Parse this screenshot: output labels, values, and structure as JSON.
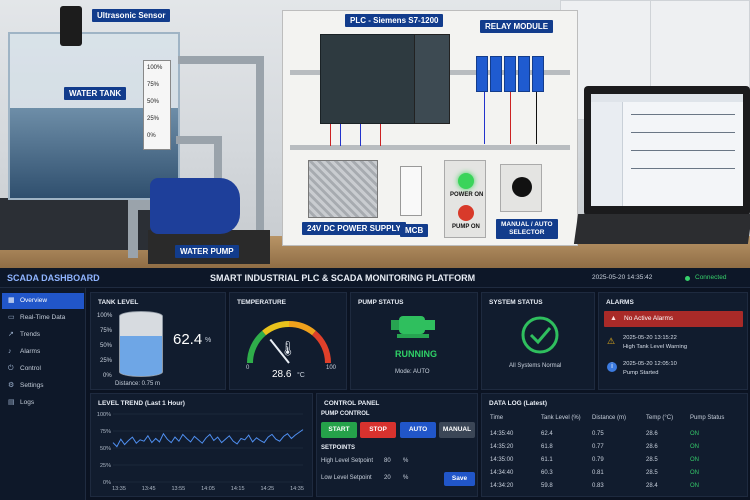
{
  "photo": {
    "labels": {
      "ultrasonic_sensor": "Ultrasonic Sensor",
      "plc": "PLC - Siemens S7-1200",
      "relay_module": "RELAY MODULE",
      "water_tank": "WATER TANK",
      "water_pump": "WATER PUMP",
      "power_supply": "24V DC POWER SUPPLY",
      "mcb": "MCB",
      "manual_auto_selector": "MANUAL / AUTO\nSELECTOR",
      "power_on": "POWER ON",
      "pump_on": "PUMP ON"
    },
    "tank_scale": [
      "100%",
      "75%",
      "50%",
      "25%",
      "0%"
    ]
  },
  "dashboard": {
    "brand": "SCADA DASHBOARD",
    "title": "SMART INDUSTRIAL PLC & SCADA MONITORING PLATFORM",
    "timestamp": "2025-05-20  14:35:42",
    "connection": "Connected",
    "nav": [
      {
        "label": "Overview",
        "icon": "grid-icon",
        "glyph": "▦",
        "active": true
      },
      {
        "label": "Real-Time Data",
        "icon": "monitor-icon",
        "glyph": "▭",
        "active": false
      },
      {
        "label": "Trends",
        "icon": "trend-icon",
        "glyph": "↗",
        "active": false
      },
      {
        "label": "Alarms",
        "icon": "bell-icon",
        "glyph": "♪",
        "active": false
      },
      {
        "label": "Control",
        "icon": "power-icon",
        "glyph": "⏻",
        "active": false
      },
      {
        "label": "Settings",
        "icon": "gear-icon",
        "glyph": "⚙",
        "active": false
      },
      {
        "label": "Logs",
        "icon": "document-icon",
        "glyph": "▤",
        "active": false
      }
    ],
    "tank_level": {
      "title": "TANK LEVEL",
      "scale": [
        "100%",
        "75%",
        "50%",
        "25%",
        "0%"
      ],
      "value": "62.4",
      "unit": "%",
      "fill": 0.624,
      "distance": "Distance: 0.75 m"
    },
    "temperature": {
      "title": "TEMPERATURE",
      "min": "0",
      "max": "100",
      "value": "28.6",
      "unit": "°C",
      "fraction": 0.286
    },
    "pump_status": {
      "title": "PUMP STATUS",
      "state": "RUNNING",
      "mode": "Mode: AUTO"
    },
    "system_status": {
      "title": "SYSTEM STATUS",
      "text": "All Systems Normal"
    },
    "alarms": {
      "title": "ALARMS",
      "banner": "No Active Alarms",
      "items": [
        {
          "time": "2025-05-20  13:15:22",
          "text": "High Tank Level Warning",
          "icon": "warning-icon"
        },
        {
          "time": "2025-05-20  12:05:10",
          "text": "Pump Started",
          "icon": "info-icon"
        }
      ]
    },
    "level_trend": {
      "title": "LEVEL TREND (Last 1 Hour)"
    },
    "control_panel": {
      "title": "CONTROL PANEL",
      "pump_control_label": "PUMP CONTROL",
      "buttons": {
        "start": "START",
        "stop": "STOP",
        "auto": "AUTO",
        "manual": "MANUAL"
      },
      "setpoints_label": "SETPOINTS",
      "high_label": "High Level Setpoint",
      "high_value": "80",
      "low_label": "Low Level Setpoint",
      "low_value": "20",
      "unit": "%",
      "save": "Save"
    },
    "data_log": {
      "title": "DATA LOG (Latest)",
      "columns": [
        "Time",
        "Tank Level (%)",
        "Distance (m)",
        "Temp (°C)",
        "Pump Status"
      ],
      "rows": [
        [
          "14:35:40",
          "62.4",
          "0.75",
          "28.6",
          "ON"
        ],
        [
          "14:35:20",
          "61.8",
          "0.77",
          "28.6",
          "ON"
        ],
        [
          "14:35:00",
          "61.1",
          "0.79",
          "28.5",
          "ON"
        ],
        [
          "14:34:40",
          "60.3",
          "0.81",
          "28.5",
          "ON"
        ],
        [
          "14:34:20",
          "59.8",
          "0.83",
          "28.4",
          "ON"
        ]
      ]
    },
    "colors": {
      "accent": "#2156c9",
      "ok": "#2fbf5e",
      "stop": "#d8322e",
      "alarm": "#c8322e"
    }
  },
  "chart_data": {
    "type": "line",
    "title": "LEVEL TREND (Last 1 Hour)",
    "xlabel": "",
    "ylabel": "",
    "ylim": [
      0,
      100
    ],
    "y_ticks": [
      "100%",
      "75%",
      "50%",
      "25%",
      "0%"
    ],
    "x_ticks": [
      "13:35",
      "13:45",
      "13:55",
      "14:05",
      "14:15",
      "14:25",
      "14:35"
    ],
    "series": [
      {
        "values": [
          58,
          52,
          63,
          55,
          61,
          66,
          57,
          62,
          60,
          68,
          58,
          64,
          59,
          71,
          63,
          58,
          66,
          60,
          70,
          64,
          59,
          67,
          62,
          57,
          65,
          70,
          61,
          66,
          58,
          63,
          68,
          60,
          56,
          64,
          62,
          69,
          59,
          65,
          61,
          58,
          66,
          70,
          63,
          60,
          67,
          71,
          64,
          69,
          73,
          77
        ]
      }
    ]
  }
}
